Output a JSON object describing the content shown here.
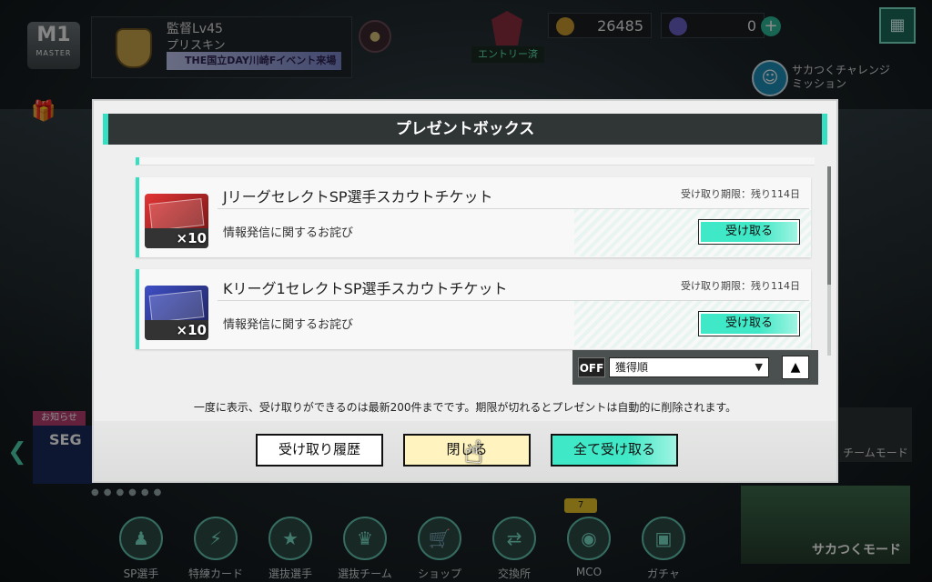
{
  "topbar": {
    "rank_badge": {
      "big": "M1",
      "small": "MASTER"
    },
    "level": "監督Lv45",
    "name": "プリスキン",
    "event": "THE国立DAY川崎Fイベント来場",
    "entry_label": "エントリー済",
    "coins": "26485",
    "gems": "0",
    "challenge_line1": "サカつくチャレンジ",
    "challenge_line2": "ミッション"
  },
  "side": {
    "news_tab": "お知らせ",
    "news_text": "SEG",
    "team_mode": "チームモード",
    "sakatsuku_mode": "サカつくモード"
  },
  "bottom_nav": {
    "items": [
      {
        "label": "SP選手",
        "icon": "player-icon"
      },
      {
        "label": "特練カード",
        "icon": "training-card-icon"
      },
      {
        "label": "選抜選手",
        "icon": "selection-player-icon"
      },
      {
        "label": "選抜チーム",
        "icon": "selection-team-icon"
      },
      {
        "label": "ショップ",
        "icon": "cart-icon"
      },
      {
        "label": "交換所",
        "icon": "exchange-icon"
      },
      {
        "label": "MCO",
        "icon": "mco-icon"
      },
      {
        "label": "ガチャ",
        "icon": "gacha-icon"
      }
    ],
    "mco_badge": "7"
  },
  "modal": {
    "title": "プレゼントボックス",
    "items": [
      {
        "title": "JリーグセレクトSP選手スカウトチケット",
        "deadline": "受け取り期限：残り114日",
        "description": "情報発信に関するお詫び",
        "quantity": "×10",
        "receive_label": "受け取る"
      },
      {
        "title": "Kリーグ1セレクトSP選手スカウトチケット",
        "deadline": "受け取り期限：残り114日",
        "description": "情報発信に関するお詫び",
        "quantity": "×10",
        "receive_label": "受け取る"
      }
    ],
    "sort": {
      "toggle": "OFF",
      "selected": "獲得順"
    },
    "notice": "一度に表示、受け取りができるのは最新200件までです。期限が切れるとプレゼントは自動的に削除されます。",
    "buttons": {
      "history": "受け取り履歴",
      "close": "閉じる",
      "receive_all": "全て受け取る"
    }
  },
  "colors": {
    "accent": "#34e0c2",
    "header_bg": "#303536",
    "close_button": "#fff4bf"
  }
}
